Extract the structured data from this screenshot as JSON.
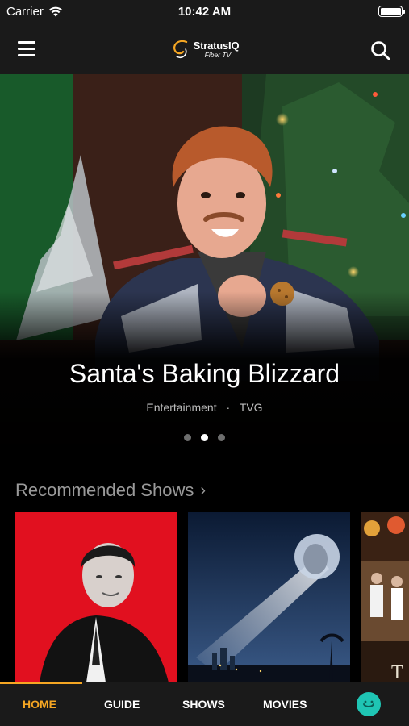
{
  "status_bar": {
    "carrier": "Carrier",
    "time": "10:42 AM"
  },
  "header": {
    "logo_name": "StratusIQ",
    "logo_sub": "Fiber TV",
    "menu_icon": "hamburger-menu-icon",
    "search_icon": "search-icon"
  },
  "hero": {
    "title": "Santa's Baking Blizzard",
    "genre": "Entertainment",
    "separator": "·",
    "rating": "TVG",
    "pages": 3,
    "active_page": 1
  },
  "recommended": {
    "title": "Recommended Shows",
    "chevron": "›",
    "tiles": [
      {
        "name": "show-tile-1"
      },
      {
        "name": "show-tile-2"
      },
      {
        "name": "show-tile-3",
        "partial_text": "T"
      }
    ]
  },
  "tabs": [
    {
      "label": "HOME",
      "active": true
    },
    {
      "label": "GUIDE",
      "active": false
    },
    {
      "label": "SHOWS",
      "active": false
    },
    {
      "label": "MOVIES",
      "active": false
    }
  ],
  "colors": {
    "accent": "#f5a623",
    "bar_bg": "#1a1a1a",
    "avatar": "#1fc5b4",
    "tile1_bg": "#e1101f"
  }
}
